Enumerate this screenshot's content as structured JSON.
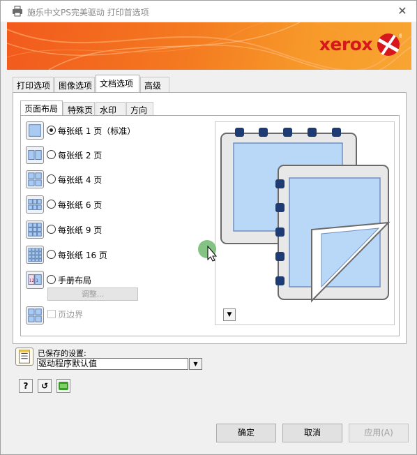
{
  "window": {
    "title": "施乐中文PS完美驱动 打印首选项"
  },
  "banner": {
    "brand": "xerox",
    "trademark": "®",
    "accent_color": "#f47a20",
    "logo_color": "#d8161e"
  },
  "tabs": [
    {
      "label": "打印选项",
      "active": false
    },
    {
      "label": "图像选项",
      "active": false
    },
    {
      "label": "文档选项",
      "active": true
    },
    {
      "label": "高级",
      "active": false
    }
  ],
  "subtabs": [
    {
      "label": "页面布局",
      "active": true
    },
    {
      "label": "特殊页",
      "active": false
    },
    {
      "label": "水印",
      "active": false
    },
    {
      "label": "方向",
      "active": false
    }
  ],
  "layout_options": [
    {
      "label": "每张纸 1 页（标准）",
      "checked": true,
      "icon": "1-up-icon"
    },
    {
      "label": "每张纸 2 页",
      "checked": false,
      "icon": "2-up-icon"
    },
    {
      "label": "每张纸 4 页",
      "checked": false,
      "icon": "4-up-icon"
    },
    {
      "label": "每张纸 6 页",
      "checked": false,
      "icon": "6-up-icon"
    },
    {
      "label": "每张纸 9 页",
      "checked": false,
      "icon": "9-up-icon"
    },
    {
      "label": "每张纸 16 页",
      "checked": false,
      "icon": "16-up-icon"
    },
    {
      "label": "手册布局",
      "checked": false,
      "icon": "booklet-icon",
      "booklet_badge": "12 1"
    }
  ],
  "adjust_button": "调整...",
  "page_border": {
    "label": "页边界",
    "checked": false,
    "enabled": false
  },
  "saved_settings": {
    "label": "已保存的设置:",
    "value": "驱动程序默认值"
  },
  "icon_buttons": [
    {
      "name": "help-icon",
      "glyph": "?"
    },
    {
      "name": "reset-icon",
      "glyph": "↺"
    }
  ],
  "buttons": {
    "ok": "确定",
    "cancel": "取消",
    "apply": "应用(A)"
  }
}
